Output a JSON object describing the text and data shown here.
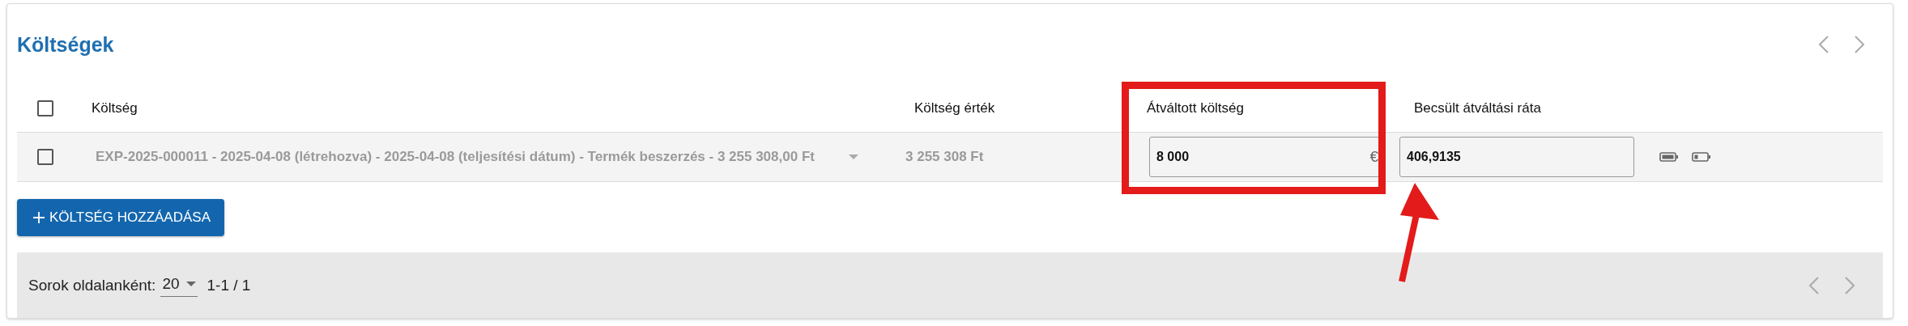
{
  "title": "Költségek",
  "columns": [
    "Költség",
    "Költség érték",
    "Átváltott költség",
    "Becsült átváltási ráta"
  ],
  "select_all": {
    "checked": false
  },
  "rows": [
    {
      "checked": false,
      "cost": "EXP-2025-000011 - 2025-04-08 (létrehozva) - 2025-04-08 (teljesítési dátum) - Termék beszerzés - 3 255 308,00 Ft",
      "value": "3 255 308 Ft",
      "converted": "8 000",
      "currency": "€",
      "rate": "406,9135"
    }
  ],
  "add_button": "KÖLTSÉG HOZZÁADÁSA",
  "footer": {
    "rows_per_page_label": "Sorok oldalanként:",
    "rows_per_page": "20",
    "range": "1-1 / 1"
  },
  "annotations": [
    {
      "kind": "box",
      "color": "#e31b1b"
    },
    {
      "kind": "arrow",
      "color": "#e31b1b"
    }
  ]
}
